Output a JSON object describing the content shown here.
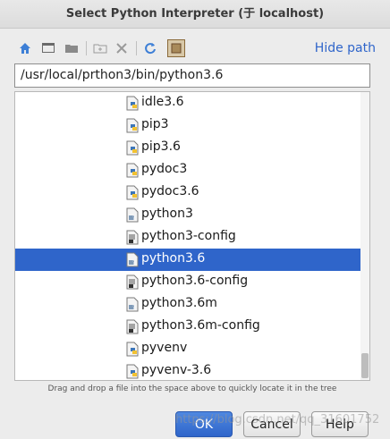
{
  "window": {
    "title": "Select Python Interpreter (于  localhost)"
  },
  "toolbar": {
    "buttons": [
      {
        "name": "home-icon",
        "color": "#3d7fd6"
      },
      {
        "name": "desktop-icon",
        "color": "#6a6a6a"
      },
      {
        "name": "project-folder-icon",
        "color": "#7a7a7a"
      },
      {
        "name": "new-folder-icon",
        "color": "#9a9a9a"
      },
      {
        "name": "delete-icon",
        "color": "#9a9a9a"
      },
      {
        "name": "refresh-icon",
        "color": "#3d7fd6"
      },
      {
        "name": "show-hidden-icon",
        "color": "#8a6a3a"
      }
    ],
    "hide_path_label": "Hide path"
  },
  "path_field": {
    "value": "/usr/local/prthon3/bin/python3.6"
  },
  "tree": {
    "items": [
      {
        "label": "idle3.6",
        "icon": "python-file-icon"
      },
      {
        "label": "pip3",
        "icon": "python-file-icon"
      },
      {
        "label": "pip3.6",
        "icon": "python-file-icon"
      },
      {
        "label": "pydoc3",
        "icon": "python-file-icon"
      },
      {
        "label": "pydoc3.6",
        "icon": "python-file-icon"
      },
      {
        "label": "python3",
        "icon": "file-icon"
      },
      {
        "label": "python3-config",
        "icon": "script-file-icon"
      },
      {
        "label": "python3.6",
        "icon": "file-icon",
        "selected": true
      },
      {
        "label": "python3.6-config",
        "icon": "script-file-icon"
      },
      {
        "label": "python3.6m",
        "icon": "file-icon"
      },
      {
        "label": "python3.6m-config",
        "icon": "script-file-icon"
      },
      {
        "label": "pyvenv",
        "icon": "python-file-icon"
      },
      {
        "label": "pyvenv-3.6",
        "icon": "python-file-icon"
      }
    ],
    "scroll_position": 0.92
  },
  "hint": "Drag and drop a file into the space above to quickly locate it in the tree",
  "buttons": {
    "ok_label": "OK",
    "cancel_label": "Cancel",
    "help_label": "Help"
  },
  "watermark": "https://blog.csdn.net/qq_31601752",
  "colors": {
    "accent": "#2f65ca",
    "selection": "#2f65ca"
  }
}
